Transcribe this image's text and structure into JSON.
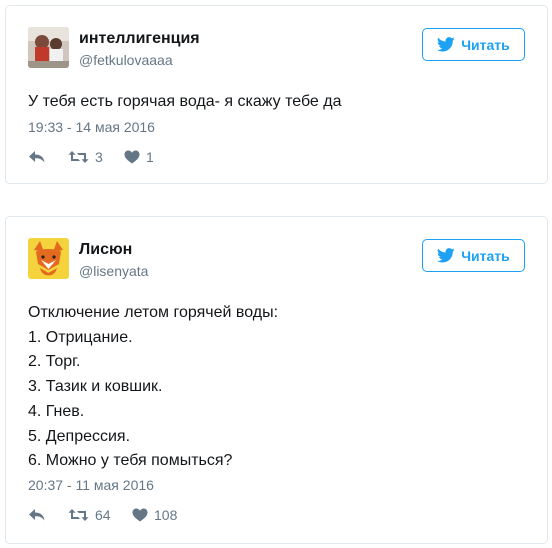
{
  "tweets": [
    {
      "name": "интеллигенция",
      "handle": "@fetkulovaaaa",
      "follow_label": "Читать",
      "text_lines": [
        "У тебя есть горячая вода- я скажу тебе да"
      ],
      "timestamp": "19:33 - 14 мая 2016",
      "retweets": "3",
      "likes": "1"
    },
    {
      "name": "Лисюн",
      "handle": "@lisenyata",
      "follow_label": "Читать",
      "text_lines": [
        "Отключение летом горячей воды:",
        "1. Отрицание.",
        "2. Торг.",
        "3. Тазик и ковшик.",
        "4. Гнев.",
        "5. Депрессия.",
        "6. Можно у тебя помыться?"
      ],
      "timestamp": "20:37 - 11 мая 2016",
      "retweets": "64",
      "likes": "108"
    }
  ],
  "colors": {
    "accent": "#1da1f2",
    "muted": "#657786",
    "border": "#e1e8ed",
    "text": "#14171a"
  },
  "icons": [
    "twitter-bird-icon",
    "reply-icon",
    "retweet-icon",
    "heart-icon"
  ]
}
